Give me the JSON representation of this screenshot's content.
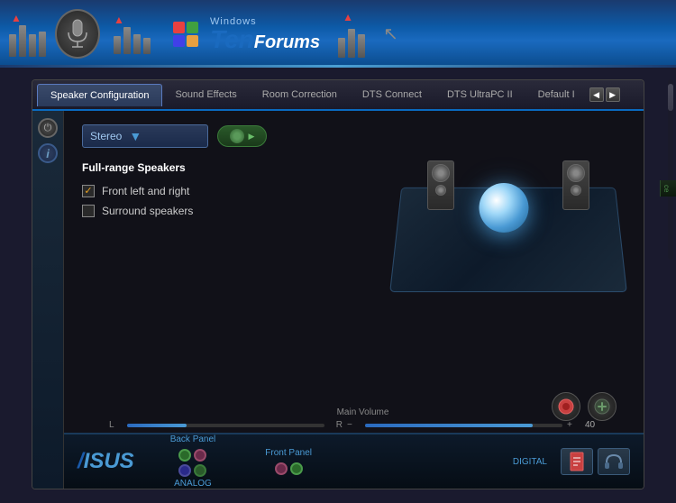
{
  "header": {
    "title_windows": "Windows",
    "title_ten": "Ten",
    "title_forums": "Forums"
  },
  "tabs": {
    "items": [
      {
        "label": "Speaker Configuration",
        "active": true
      },
      {
        "label": "Sound Effects",
        "active": false
      },
      {
        "label": "Room Correction",
        "active": false
      },
      {
        "label": "DTS Connect",
        "active": false
      },
      {
        "label": "DTS UltraPC II",
        "active": false
      },
      {
        "label": "Default I",
        "active": false
      }
    ]
  },
  "speaker_config": {
    "dropdown_value": "Stereo",
    "full_range_label": "Full-range Speakers",
    "checkbox1_label": "Front left and right",
    "checkbox1_checked": true,
    "checkbox2_label": "Surround speakers",
    "checkbox2_checked": false
  },
  "volume": {
    "label": "Main Volume",
    "left_label": "L",
    "right_label": "R",
    "minus_label": "−",
    "plus_label": "+",
    "value": "40"
  },
  "bottom_panel": {
    "asus_logo": "/ISUS",
    "back_panel_label": "Back Panel",
    "front_panel_label": "Front Panel",
    "analog_label": "ANALOG",
    "digital_label": "DIGITAL"
  },
  "icons": {
    "close": "✕",
    "minimize": "−",
    "play": "▶",
    "arrow_down": "▼",
    "arrow_left": "◀",
    "arrow_right": "▶",
    "check": "✓",
    "info": "i",
    "power": "⏻"
  }
}
